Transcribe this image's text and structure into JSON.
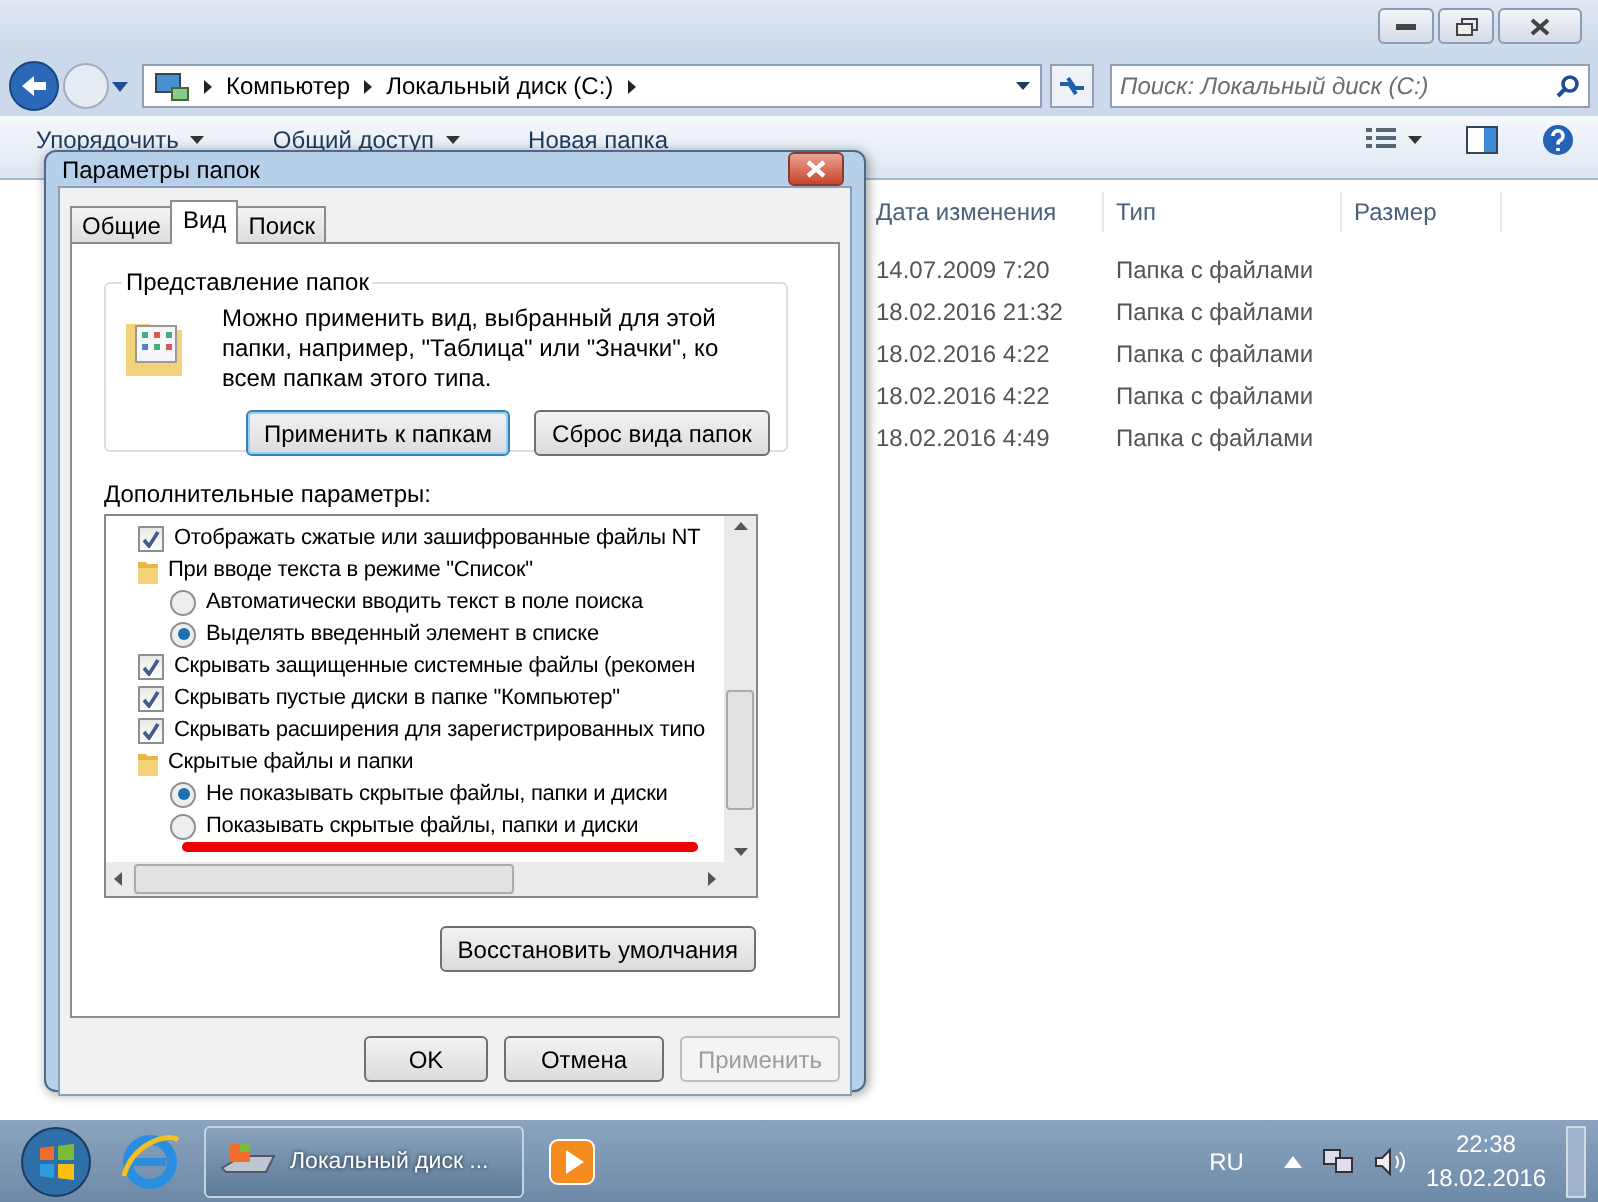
{
  "explorer": {
    "breadcrumb": [
      "Компьютер",
      "Локальный диск (C:)"
    ],
    "search": {
      "placeholder": "Поиск: Локальный диск (C:)"
    },
    "toolbar": [
      {
        "label": "Упорядочить",
        "dropdown": true
      },
      {
        "label": "Общий доступ",
        "dropdown": true
      },
      {
        "label": "Новая папка",
        "dropdown": false
      }
    ],
    "columns": [
      "Дата изменения",
      "Тип",
      "Размер"
    ],
    "rows": [
      {
        "date": "14.07.2009 7:20",
        "type": "Папка с файлами"
      },
      {
        "date": "18.02.2016 21:32",
        "type": "Папка с файлами"
      },
      {
        "date": "18.02.2016 4:22",
        "type": "Папка с файлами"
      },
      {
        "date": "18.02.2016 4:22",
        "type": "Папка с файлами"
      },
      {
        "date": "18.02.2016 4:49",
        "type": "Папка с файлами"
      }
    ]
  },
  "dialog": {
    "title": "Параметры папок",
    "tabs": [
      {
        "label": "Общие",
        "selected": false
      },
      {
        "label": "Вид",
        "selected": true
      },
      {
        "label": "Поиск",
        "selected": false
      }
    ],
    "group_title": "Представление папок",
    "description": "Можно применить вид, выбранный для этой папки, например, \"Таблица\" или \"Значки\", ко всем папкам этого типа.",
    "group_buttons": [
      "Применить к папкам",
      "Сброс вида папок"
    ],
    "advanced_label": "Дополнительные параметры:",
    "options": [
      {
        "kind": "checkbox",
        "label": "Отображать сжатые или зашифрованные файлы NT",
        "checked": true
      },
      {
        "kind": "folder",
        "label": "При вводе текста в режиме \"Список\"",
        "children": [
          {
            "kind": "radio",
            "label": "Автоматически вводить текст в поле поиска",
            "selected": false
          },
          {
            "kind": "radio",
            "label": "Выделять введенный элемент в списке",
            "selected": true
          }
        ]
      },
      {
        "kind": "checkbox",
        "label": "Скрывать защищенные системные файлы (рекомен",
        "checked": true
      },
      {
        "kind": "checkbox",
        "label": "Скрывать пустые диски в папке \"Компьютер\"",
        "checked": true
      },
      {
        "kind": "checkbox",
        "label": "Скрывать расширения для зарегистрированных типо",
        "checked": true
      },
      {
        "kind": "folder",
        "label": "Скрытые файлы и папки",
        "children": [
          {
            "kind": "radio",
            "label": "Не показывать скрытые файлы, папки и диски",
            "selected": true
          },
          {
            "kind": "radio",
            "label": "Показывать скрытые файлы, папки и диски",
            "selected": false,
            "highlighted": true
          }
        ]
      }
    ],
    "restore_button": "Восстановить умолчания",
    "footer_buttons": [
      {
        "label": "OK",
        "disabled": false
      },
      {
        "label": "Отмена",
        "disabled": false
      },
      {
        "label": "Применить",
        "disabled": true
      }
    ]
  },
  "taskbar": {
    "task": "Локальный диск ...",
    "language": "RU",
    "time": "22:38",
    "date": "18.02.2016"
  }
}
